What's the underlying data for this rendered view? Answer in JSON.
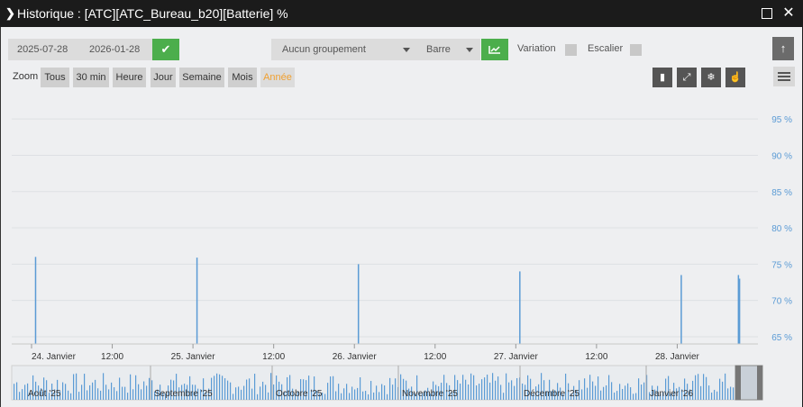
{
  "window": {
    "title": "Historique : [ATC][ATC_Bureau_b20][Batterie] %",
    "chevron_icon": "chevron-right-icon",
    "maximize_icon": "maximize-icon",
    "close_icon": "close-icon"
  },
  "controls": {
    "date_start": "2025-07-28",
    "date_end": "2026-01-28",
    "validate_icon": "check-icon",
    "grouping": "Aucun groupement",
    "chart_type": "Barre",
    "chart_icon": "area-chart-icon",
    "variation_label": "Variation",
    "stairs_label": "Escalier"
  },
  "zoom": {
    "label": "Zoom",
    "buttons": [
      "Tous",
      "30 min",
      "Heure",
      "Jour",
      "Semaine",
      "Mois",
      "Année"
    ],
    "active": "Année",
    "active_color": "#f0a030"
  },
  "tools": [
    "column-icon",
    "resize-icon",
    "snowflake-icon",
    "hand-pointer-icon"
  ],
  "side": {
    "up_icon": "arrow-up-icon",
    "menu_icon": "hamburger-menu-icon"
  },
  "colors": {
    "series": "#5b9bd5",
    "accent_green": "#4cae4c",
    "axis_text": "#5b9bd5"
  },
  "chart_data": {
    "type": "bar",
    "title": "",
    "y_ticks": [
      "65 %",
      "70 %",
      "75 %",
      "80 %",
      "85 %",
      "90 %",
      "95 %"
    ],
    "ylim": [
      64,
      98
    ],
    "x_ticks": [
      "24. Janvier",
      "12:00",
      "25. Janvier",
      "12:00",
      "26. Janvier",
      "12:00",
      "27. Janvier",
      "12:00",
      "28. Janvier"
    ],
    "xlim": [
      "2026-01-24T00:00",
      "2026-01-28T12:00"
    ],
    "series": [
      {
        "x": [
          "2026-01-24T00:30",
          "2026-01-25T00:30",
          "2026-01-26T00:30",
          "2026-01-27T00:30",
          "2026-01-28T00:30",
          "2026-01-28T09:00",
          "2026-01-28T09:10"
        ],
        "values": [
          76,
          75.9,
          75,
          74,
          73.5,
          73.5,
          73
        ]
      }
    ],
    "navigator": {
      "labels": [
        "Août '25",
        "Septembre '25",
        "Octobre '25",
        "Novembre '25",
        "Décembre '25",
        "Janvier '26"
      ]
    }
  }
}
